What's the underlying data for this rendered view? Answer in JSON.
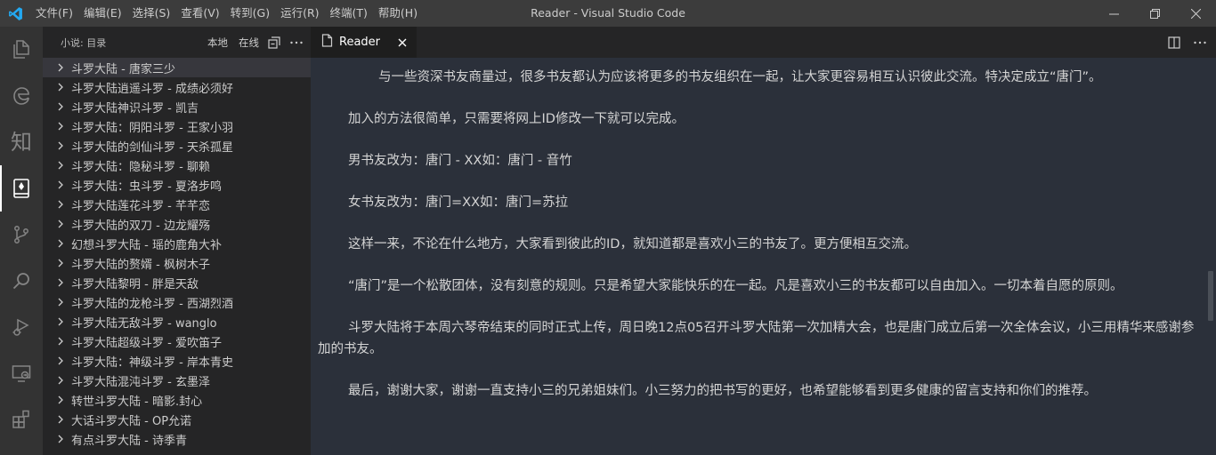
{
  "titlebar": {
    "menus": [
      "文件(F)",
      "编辑(E)",
      "选择(S)",
      "查看(V)",
      "转到(G)",
      "运行(R)",
      "终端(T)",
      "帮助(H)"
    ],
    "title": "Reader - Visual Studio Code"
  },
  "activitybar": {
    "items": [
      "explorer-icon",
      "edge-icon",
      "知",
      "reader-icon",
      "source-control-icon",
      "search-icon",
      "run-debug-icon",
      "remote-explorer-icon",
      "extensions-icon"
    ]
  },
  "sidebar": {
    "title": "小说: 目录",
    "local_label": "本地",
    "online_label": "在线",
    "items": [
      "斗罗大陆 - 唐家三少",
      "斗罗大陆逍遥斗罗 - 成绩必须好",
      "斗罗大陆神识斗罗 - 凯吉",
      "斗罗大陆：阴阳斗罗 - 王家小羽",
      "斗罗大陆的剑仙斗罗 - 天杀孤星",
      "斗罗大陆：隐秘斗罗 - 聊赖",
      "斗罗大陆：虫斗罗 - 夏洛步鸣",
      "斗罗大陆莲花斗罗 - 芊芊恋",
      "斗罗大陆的双刀 - 边龙耀殇",
      "幻想斗罗大陆 - 瑶的鹿角大补",
      "斗罗大陆的赘婿 - 枫树木子",
      "斗罗大陆黎明 - 胖是天敌",
      "斗罗大陆的龙枪斗罗 - 西湖烈酒",
      "斗罗大陆无敌斗罗 - wanglo",
      "斗罗大陆超级斗罗 - 爱吹笛子",
      "斗罗大陆：神级斗罗 - 岸本青史",
      "斗罗大陆混沌斗罗 - 玄墨泽",
      "转世斗罗大陆 - 暗影.封心",
      "大话斗罗大陆 - OP允诺",
      "有点斗罗大陆 - 诗季青"
    ]
  },
  "editor": {
    "tab_label": "Reader",
    "paragraphs": [
      "与一些资深书友商量过，很多书友都认为应该将更多的书友组织在一起，让大家更容易相互认识彼此交流。特决定成立“唐门”。",
      "加入的方法很简单，只需要将网上ID修改一下就可以完成。",
      "男书友改为：唐门 - XX如：唐门 - 音竹",
      "女书友改为：唐门=XX如：唐门=苏拉",
      "这样一来，不论在什么地方，大家看到彼此的ID，就知道都是喜欢小三的书友了。更方便相互交流。",
      "“唐门”是一个松散团体，没有刻意的规则。只是希望大家能快乐的在一起。凡是喜欢小三的书友都可以自由加入。一切本着自愿的原则。",
      "斗罗大陆将于本周六琴帝结束的同时正式上传，周日晚12点05召开斗罗大陆第一次加精大会，也是唐门成立后第一次全体会议，小三用精华来感谢参加的书友。",
      "最后，谢谢大家，谢谢一直支持小三的兄弟姐妹们。小三努力的把书写的更好，也希望能够看到更多健康的留言支持和你们的推荐。"
    ]
  },
  "colors": {
    "titlebar": "#3c3c3c",
    "activitybar": "#333333",
    "sidebar": "#252526",
    "reader_bg": "#2b303a",
    "accent": "#007acc"
  }
}
